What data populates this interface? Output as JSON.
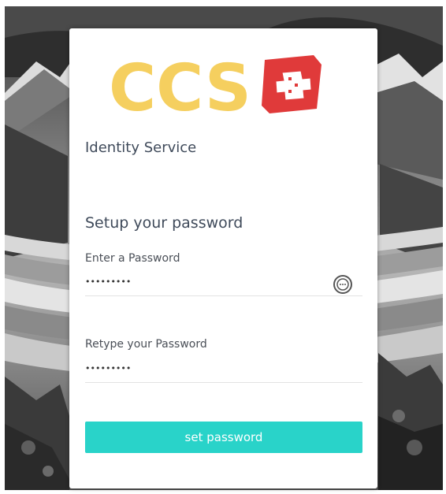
{
  "logo": {
    "text": "CCS",
    "text_color": "#f5cf5f",
    "flag_color": "#e03a3a",
    "icon": "swiss-flag-icon"
  },
  "service_title": "Identity Service",
  "form": {
    "heading": "Setup your password",
    "password": {
      "label": "Enter a Password",
      "value": "•••••••••"
    },
    "reveal_icon": "show-password-icon",
    "retype": {
      "label": "Retype your Password",
      "value": "•••••••••"
    },
    "submit_label": "set password"
  },
  "colors": {
    "accent": "#29d3c9",
    "text": "#3f4a5a"
  }
}
